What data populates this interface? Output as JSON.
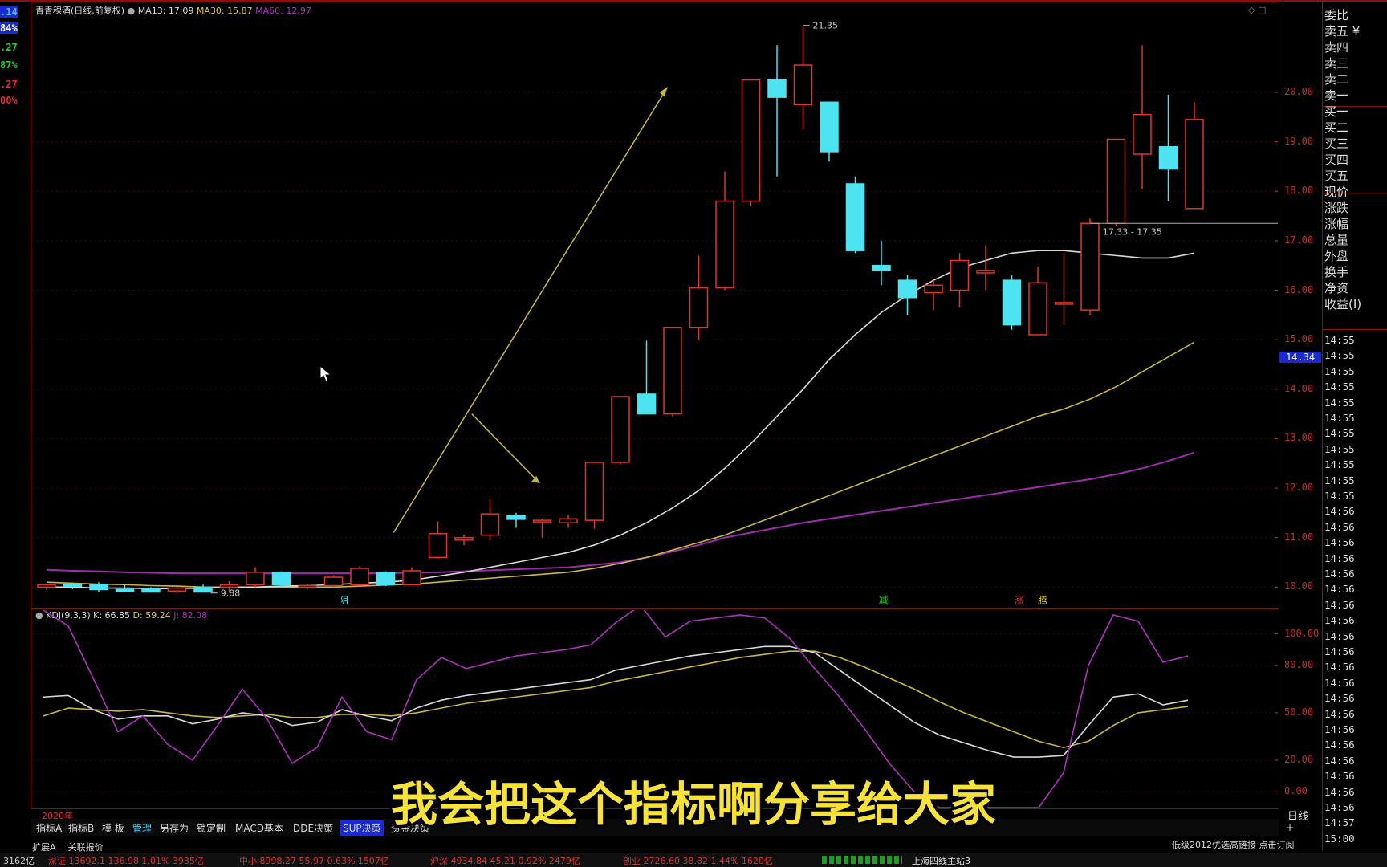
{
  "chart_header": {
    "title": "青青稞酒(日线,前复权)",
    "ma13_label": "MA13: 17.09",
    "ma30_label": "MA30: 15.87",
    "ma60_label": "MA60: 12.97"
  },
  "left_strip": {
    "values": [
      ".14",
      "84%",
      ".27",
      "87%",
      ".27",
      "00%"
    ]
  },
  "annotations": {
    "high_label": "21.35",
    "low_label": "9.88",
    "range_label": "17.33 - 17.35",
    "marker_a": "阴",
    "marker_b": "减",
    "marker_c": "涨",
    "marker_d": "腾",
    "year_label": "2020年",
    "cursor_price": "14.34"
  },
  "price_axis": {
    "ticks": [
      "20.00",
      "19.00",
      "18.00",
      "17.00",
      "16.00",
      "15.00",
      "14.00",
      "13.00",
      "12.00",
      "11.00",
      "10.00"
    ]
  },
  "kdj_header": {
    "name": "KDJ(9,3,3)",
    "k_label": "K: 66.85",
    "d_label": "D: 59.24",
    "j_label": "J: 82.08"
  },
  "kdj_axis": {
    "ticks": [
      "100.00",
      "80.00",
      "50.00",
      "20.00",
      "0.00"
    ]
  },
  "right_panel": {
    "items": [
      "委比",
      "卖五 ¥",
      "卖四",
      "卖三",
      "卖二",
      "卖一",
      "买一",
      "买二",
      "买三",
      "买四",
      "买五",
      "现价",
      "涨跌",
      "涨幅",
      "总量",
      "外盘",
      "换手",
      "净资",
      "收益(I)"
    ],
    "times": [
      "14:55",
      "14:55",
      "14:55",
      "14:55",
      "14:55",
      "14:55",
      "14:55",
      "14:55",
      "14:55",
      "14:55",
      "14:55",
      "14:56",
      "14:56",
      "14:56",
      "14:56",
      "14:56",
      "14:56",
      "14:56",
      "14:56",
      "14:56",
      "14:56",
      "14:56",
      "14:56",
      "14:56",
      "14:56",
      "14:56",
      "14:56",
      "14:56",
      "14:56",
      "14:56",
      "14:56",
      "14:57",
      "15:00"
    ],
    "period_label": "日线"
  },
  "bottom_tabs": [
    "指标A",
    "指标B",
    "模 板",
    "管理",
    "另存为",
    "锁定制",
    "MACD基本",
    "DDE决策",
    "SUP决策",
    "资金决策"
  ],
  "bottom_row2": [
    "扩展A",
    "关联报价"
  ],
  "status_bar": {
    "item1": "3162亿",
    "item2": "深证 13692.1 136.98 1.01% 3935亿",
    "item3": "中小 8998.27 55.97 0.63% 1507亿",
    "item4": "沪深 4934.84 45.21 0.92% 2479亿",
    "item5": "创业 2726.60 38.82 1.44% 1620亿",
    "item6": "上海四线主站3",
    "item7": "低级2012优选高链接 点击订阅"
  },
  "subtitle": "我会把这个指标啊分享给大家",
  "chart_data": {
    "type": "candlestick",
    "ylim": [
      9.6,
      21.8
    ],
    "candles": [
      {
        "o": 10.0,
        "h": 10.07,
        "l": 9.95,
        "c": 10.05
      },
      {
        "o": 10.05,
        "h": 10.08,
        "l": 9.96,
        "c": 10.03
      },
      {
        "o": 10.05,
        "h": 10.1,
        "l": 9.9,
        "c": 9.95
      },
      {
        "o": 9.95,
        "h": 10.06,
        "l": 9.9,
        "c": 9.92
      },
      {
        "o": 9.97,
        "h": 10.0,
        "l": 9.9,
        "c": 9.9
      },
      {
        "o": 9.92,
        "h": 10.0,
        "l": 9.88,
        "c": 9.98
      },
      {
        "o": 10.0,
        "h": 10.05,
        "l": 9.9,
        "c": 9.9
      },
      {
        "o": 10.0,
        "h": 10.12,
        "l": 9.88,
        "c": 10.05
      },
      {
        "o": 10.05,
        "h": 10.4,
        "l": 10.0,
        "c": 10.3
      },
      {
        "o": 10.3,
        "h": 10.32,
        "l": 10.0,
        "c": 10.05
      },
      {
        "o": 10.0,
        "h": 10.06,
        "l": 9.96,
        "c": 10.03
      },
      {
        "o": 10.03,
        "h": 10.24,
        "l": 10.0,
        "c": 10.2
      },
      {
        "o": 10.05,
        "h": 10.42,
        "l": 10.05,
        "c": 10.38
      },
      {
        "o": 10.3,
        "h": 10.32,
        "l": 10.02,
        "c": 10.05
      },
      {
        "o": 10.05,
        "h": 10.4,
        "l": 10.05,
        "c": 10.33
      },
      {
        "o": 10.6,
        "h": 11.33,
        "l": 10.58,
        "c": 11.08
      },
      {
        "o": 10.95,
        "h": 11.06,
        "l": 10.85,
        "c": 11.0
      },
      {
        "o": 11.05,
        "h": 11.78,
        "l": 10.95,
        "c": 11.48
      },
      {
        "o": 11.45,
        "h": 11.5,
        "l": 11.2,
        "c": 11.37
      },
      {
        "o": 11.35,
        "h": 11.38,
        "l": 11.0,
        "c": 11.35
      },
      {
        "o": 11.3,
        "h": 11.45,
        "l": 11.2,
        "c": 11.38
      },
      {
        "o": 11.35,
        "h": 11.95,
        "l": 11.18,
        "c": 12.52
      },
      {
        "o": 12.52,
        "h": 12.52,
        "l": 12.48,
        "c": 13.85
      },
      {
        "o": 13.9,
        "h": 14.98,
        "l": 13.5,
        "c": 13.5
      },
      {
        "o": 13.5,
        "h": 15.25,
        "l": 13.45,
        "c": 15.25
      },
      {
        "o": 15.25,
        "h": 16.7,
        "l": 15.0,
        "c": 16.05
      },
      {
        "o": 16.05,
        "h": 18.4,
        "l": 16.0,
        "c": 17.8
      },
      {
        "o": 17.8,
        "h": 20.25,
        "l": 17.7,
        "c": 20.25
      },
      {
        "o": 20.25,
        "h": 20.95,
        "l": 18.3,
        "c": 19.9
      },
      {
        "o": 19.75,
        "h": 21.35,
        "l": 19.25,
        "c": 20.55
      },
      {
        "o": 19.8,
        "h": 19.8,
        "l": 18.6,
        "c": 18.8
      },
      {
        "o": 18.15,
        "h": 18.3,
        "l": 16.75,
        "c": 16.8
      },
      {
        "o": 16.5,
        "h": 17.0,
        "l": 16.1,
        "c": 16.4
      },
      {
        "o": 16.2,
        "h": 16.3,
        "l": 15.5,
        "c": 15.85
      },
      {
        "o": 15.95,
        "h": 16.2,
        "l": 15.6,
        "c": 16.1
      },
      {
        "o": 16.0,
        "h": 16.75,
        "l": 15.65,
        "c": 16.6
      },
      {
        "o": 16.35,
        "h": 16.9,
        "l": 16.0,
        "c": 16.4
      },
      {
        "o": 16.2,
        "h": 16.3,
        "l": 15.2,
        "c": 15.3
      },
      {
        "o": 15.1,
        "h": 16.48,
        "l": 15.1,
        "c": 16.15
      },
      {
        "o": 15.75,
        "h": 16.75,
        "l": 15.3,
        "c": 15.75
      },
      {
        "o": 15.6,
        "h": 17.45,
        "l": 15.5,
        "c": 17.35
      },
      {
        "o": 17.35,
        "h": 19.05,
        "l": 17.3,
        "c": 19.05
      },
      {
        "o": 18.75,
        "h": 20.95,
        "l": 18.05,
        "c": 19.55
      },
      {
        "o": 18.9,
        "h": 19.95,
        "l": 17.8,
        "c": 18.45
      },
      {
        "o": 17.65,
        "h": 19.8,
        "l": 17.65,
        "c": 19.45
      }
    ],
    "ma13": [
      10.0,
      10.0,
      9.98,
      9.98,
      9.97,
      9.97,
      9.98,
      10.0,
      10.0,
      10.02,
      10.03,
      10.05,
      10.08,
      10.1,
      10.14,
      10.22,
      10.3,
      10.4,
      10.5,
      10.6,
      10.7,
      10.85,
      11.05,
      11.3,
      11.6,
      11.95,
      12.4,
      12.9,
      13.45,
      14.0,
      14.6,
      15.1,
      15.55,
      15.9,
      16.2,
      16.45,
      16.6,
      16.75,
      16.8,
      16.8,
      16.75,
      16.7,
      16.65,
      16.65,
      16.75
    ],
    "ma30": [
      10.1,
      10.08,
      10.06,
      10.05,
      10.03,
      10.02,
      10.0,
      10.0,
      10.0,
      10.0,
      10.0,
      10.0,
      10.02,
      10.04,
      10.06,
      10.1,
      10.14,
      10.18,
      10.22,
      10.26,
      10.3,
      10.38,
      10.48,
      10.6,
      10.75,
      10.9,
      11.05,
      11.25,
      11.45,
      11.65,
      11.85,
      12.05,
      12.25,
      12.45,
      12.65,
      12.85,
      13.05,
      13.25,
      13.45,
      13.6,
      13.8,
      14.05,
      14.35,
      14.65,
      14.95
    ],
    "ma60": [
      10.35,
      10.33,
      10.32,
      10.3,
      10.29,
      10.28,
      10.28,
      10.28,
      10.28,
      10.28,
      10.28,
      10.28,
      10.28,
      10.28,
      10.29,
      10.3,
      10.32,
      10.34,
      10.36,
      10.38,
      10.4,
      10.45,
      10.5,
      10.6,
      10.72,
      10.85,
      11.0,
      11.1,
      11.2,
      11.3,
      11.38,
      11.46,
      11.54,
      11.62,
      11.7,
      11.78,
      11.86,
      11.94,
      12.02,
      12.1,
      12.18,
      12.28,
      12.4,
      12.55,
      12.72
    ],
    "kdj": {
      "ylim": [
        -10,
        115
      ],
      "K": [
        60,
        61,
        52,
        46,
        48,
        48,
        43,
        46,
        50,
        48,
        42,
        44,
        52,
        48,
        45,
        53,
        58,
        61,
        63,
        65,
        67,
        69,
        71,
        77,
        80,
        83,
        86,
        88,
        90,
        92,
        92,
        88,
        77,
        66,
        55,
        44,
        36,
        31,
        26,
        22,
        22,
        23,
        42,
        60,
        62,
        55,
        58
      ],
      "D": [
        48,
        53,
        52,
        51,
        52,
        50,
        48,
        47,
        48,
        49,
        47,
        47,
        49,
        49,
        48,
        50,
        53,
        56,
        58,
        60,
        62,
        64,
        66,
        70,
        73,
        76,
        79,
        82,
        85,
        87,
        89,
        89,
        85,
        79,
        72,
        65,
        57,
        50,
        44,
        38,
        32,
        28,
        32,
        42,
        50,
        52,
        54
      ],
      "J": [
        115,
        105,
        72,
        38,
        48,
        30,
        20,
        42,
        65,
        46,
        18,
        28,
        60,
        38,
        33,
        71,
        85,
        78,
        82,
        86,
        88,
        90,
        93,
        107,
        118,
        98,
        108,
        110,
        112,
        110,
        97,
        78,
        60,
        40,
        18,
        0,
        -10,
        -10,
        -10,
        -10,
        -10,
        12,
        80,
        112,
        108,
        82,
        86
      ]
    }
  }
}
